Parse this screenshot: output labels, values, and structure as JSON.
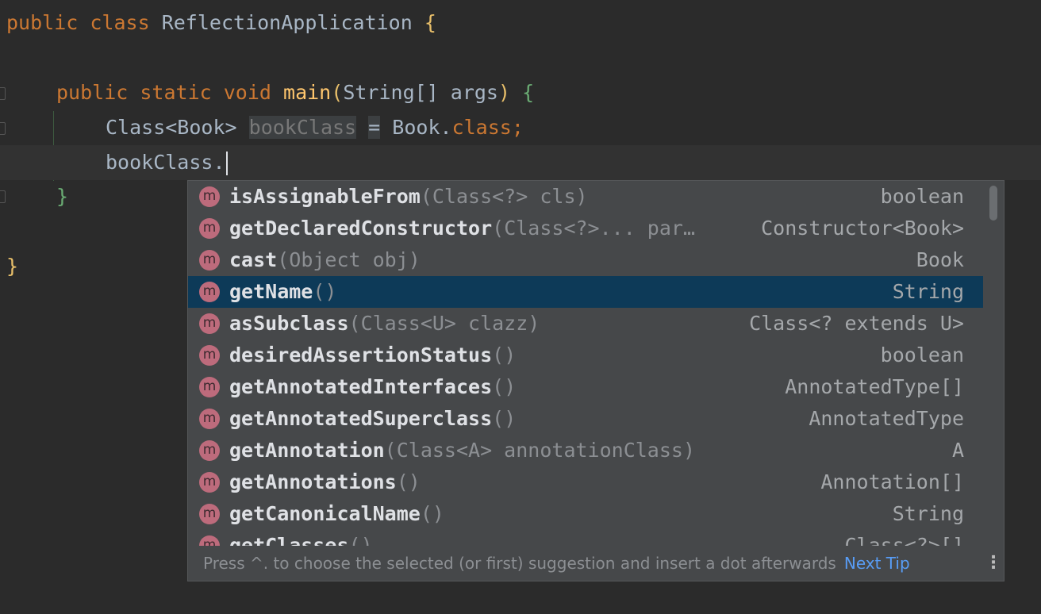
{
  "code": {
    "line1": {
      "kw1": "public",
      "kw2": "class",
      "name": "ReflectionApplication",
      "brace": "{"
    },
    "line2": {
      "kw1": "public",
      "kw2": "static",
      "kw3": "void",
      "method": "main",
      "open": "(",
      "params": "String[] args",
      "close": ")",
      "brace": "{"
    },
    "line3": {
      "type": "Class<Book>",
      "var": "bookClass",
      "eq": "=",
      "ref": "Book.",
      "kw": "class",
      "semi": ";"
    },
    "line4": {
      "text": "bookClass."
    },
    "line5": {
      "brace": "}"
    },
    "line6": {
      "brace": "}"
    }
  },
  "completion": {
    "badge": "m",
    "items": [
      {
        "name": "isAssignableFrom",
        "params": "(Class<?> cls)",
        "ret": "boolean"
      },
      {
        "name": "getDeclaredConstructor",
        "params": "(Class<?>... par…",
        "ret": "Constructor<Book>"
      },
      {
        "name": "cast",
        "params": "(Object obj)",
        "ret": "Book"
      },
      {
        "name": "getName",
        "params": "()",
        "ret": "String"
      },
      {
        "name": "asSubclass",
        "params": "(Class<U> clazz)",
        "ret": "Class<? extends U>"
      },
      {
        "name": "desiredAssertionStatus",
        "params": "()",
        "ret": "boolean"
      },
      {
        "name": "getAnnotatedInterfaces",
        "params": "()",
        "ret": "AnnotatedType[]"
      },
      {
        "name": "getAnnotatedSuperclass",
        "params": "()",
        "ret": "AnnotatedType"
      },
      {
        "name": "getAnnotation",
        "params": "(Class<A> annotationClass)",
        "ret": "A"
      },
      {
        "name": "getAnnotations",
        "params": "()",
        "ret": "Annotation[]"
      },
      {
        "name": "getCanonicalName",
        "params": "()",
        "ret": "String"
      },
      {
        "name": "getClasses",
        "params": "()",
        "ret": "Class<?>[]"
      }
    ],
    "selected_index": 3,
    "footer": {
      "tip": "Press ^. to choose the selected (or first) suggestion and insert a dot afterwards",
      "next_tip": "Next Tip",
      "more_icon": "vertical-ellipsis-icon"
    }
  },
  "colors": {
    "background": "#2b2b2b",
    "keyword": "#cc7832",
    "method": "#ffc66d",
    "selection": "#0d3a58",
    "badge": "#bd6b7c",
    "link": "#589df6"
  }
}
